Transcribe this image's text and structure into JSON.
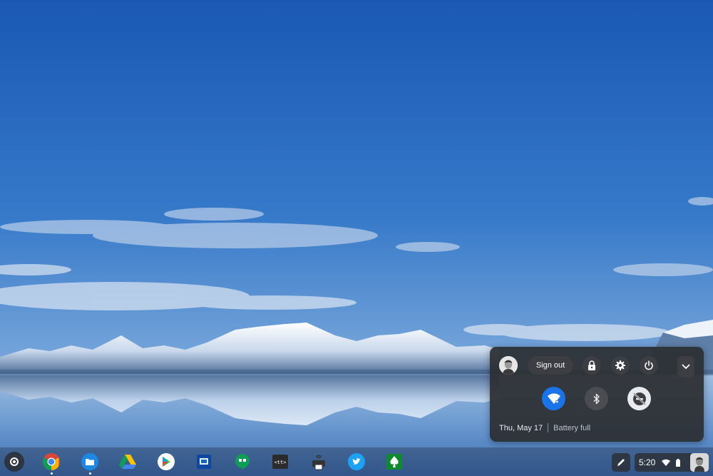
{
  "shelf": {
    "apps": [
      {
        "name": "Chrome",
        "running": true
      },
      {
        "name": "Files",
        "running": true
      },
      {
        "name": "Google Drive",
        "running": false
      },
      {
        "name": "Google Play Store",
        "running": false
      },
      {
        "name": "Chrome Remote Desktop",
        "running": false
      },
      {
        "name": "Hangouts",
        "running": false
      },
      {
        "name": "Secure Shell",
        "running": false
      },
      {
        "name": "Printer",
        "running": false
      },
      {
        "name": "Twitter",
        "running": false
      },
      {
        "name": "Solitaire",
        "running": false
      }
    ]
  },
  "status_area": {
    "time": "5:20",
    "icons": [
      "wifi-icon",
      "battery-icon"
    ]
  },
  "system_tray": {
    "sign_out_label": "Sign out",
    "date": "Thu, May 17",
    "battery_status": "Battery full",
    "buttons": [
      "lock-icon",
      "settings-icon",
      "power-icon",
      "chevron-down-icon"
    ],
    "features": [
      {
        "name": "wifi",
        "state": "on"
      },
      {
        "name": "bluetooth",
        "state": "off"
      },
      {
        "name": "do-not-disturb",
        "state": "on"
      }
    ]
  },
  "colors": {
    "accent": "#1a73e8",
    "tray_background": "#2c2e32",
    "tray_button": "#3c3e43"
  }
}
